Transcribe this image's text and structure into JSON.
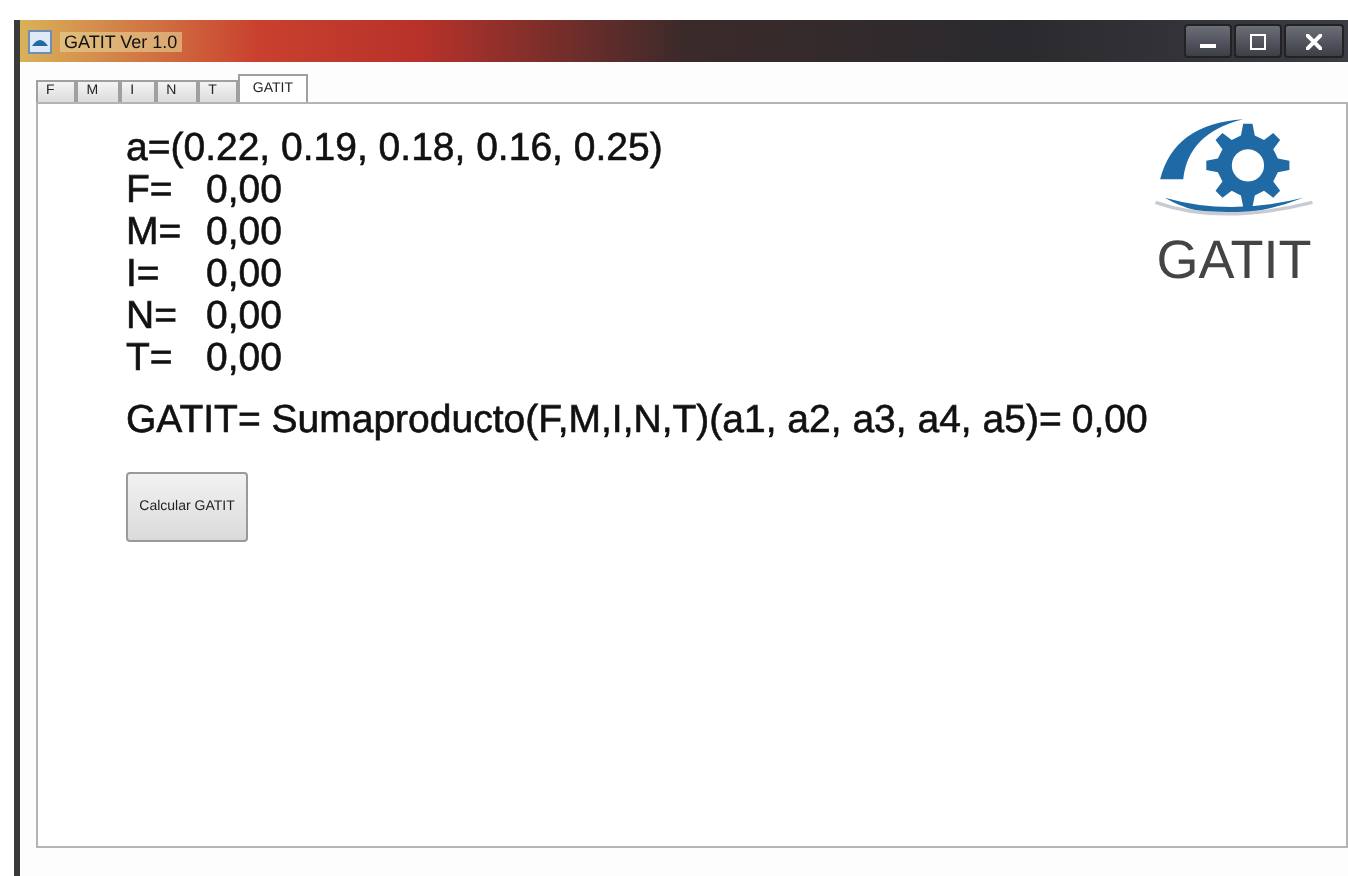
{
  "window": {
    "title": "GATIT Ver 1.0"
  },
  "tabs": [
    {
      "label": "F",
      "selected": false
    },
    {
      "label": "M",
      "selected": false
    },
    {
      "label": "I",
      "selected": false
    },
    {
      "label": "N",
      "selected": false
    },
    {
      "label": "T",
      "selected": false
    },
    {
      "label": "GATIT",
      "selected": true
    }
  ],
  "weights": "a=(0.22, 0.19, 0.18, 0.16, 0.25)",
  "variables": [
    {
      "label": "F=",
      "value": "0,00"
    },
    {
      "label": "M=",
      "value": "0,00"
    },
    {
      "label": "I=",
      "value": "0,00"
    },
    {
      "label": "N=",
      "value": "0,00"
    },
    {
      "label": "T=",
      "value": "0,00"
    }
  ],
  "formula": {
    "label": "GATIT= Sumaproducto(F,M,I,N,T)(a1, a2, a3, a4, a5)=",
    "value": "0,00"
  },
  "button": "Calcular GATIT",
  "logo": {
    "text": "GATIT"
  }
}
